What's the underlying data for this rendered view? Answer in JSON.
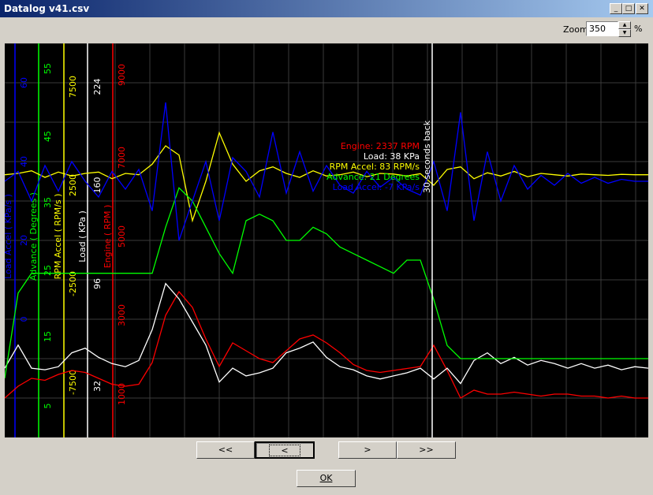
{
  "window": {
    "title": "Datalog v41.csv",
    "minimize": "_",
    "maximize": "□",
    "close": "✕"
  },
  "zoom": {
    "label": "Zoom",
    "value": "350",
    "unit": "%"
  },
  "buttons": {
    "first": "<<",
    "prev": "<",
    "next": ">",
    "last": ">>",
    "ok": "OK"
  },
  "colors": {
    "engine": "#ff0000",
    "load": "#ffffff",
    "rpm_accel": "#ffff00",
    "advance": "#00ff00",
    "load_accel": "#0000ff"
  },
  "axes": {
    "load_accel": {
      "label": "Load Accel ( KPa/s )"
    },
    "advance": {
      "label": "Advance ( Degrees )",
      "ticks": [
        "55",
        "45",
        "35",
        "25",
        "15",
        "5"
      ]
    },
    "rpm_accel": {
      "label": "RPM Accel ( RPM/s )",
      "ticks": [
        "7500",
        "2500",
        "-2500",
        "-7500"
      ]
    },
    "load": {
      "label": "Load ( KPa )",
      "ticks": [
        "224",
        "160",
        "96",
        "32"
      ]
    },
    "engine": {
      "label": "Engine ( RPM )",
      "ticks": [
        "9000",
        "7000",
        "5000",
        "3000",
        "1000"
      ]
    },
    "blue_ticks": [
      "60",
      "40",
      "20",
      "0"
    ]
  },
  "cursor": {
    "label": "30 seconds back"
  },
  "readout": {
    "engine": "Engine: 2337 RPM",
    "load": "Load: 38 KPa",
    "rpm_accel": "RPM Accel: 83 RPM/s",
    "advance": "Advance: 21 Degrees",
    "load_accel": "Load Accel: -7 KPa/s"
  },
  "chart_data": {
    "type": "line",
    "series": [
      {
        "name": "Engine",
        "values": [
          1000,
          1300,
          1500,
          1450,
          1600,
          1700,
          1650,
          1500,
          1350,
          1300,
          1350,
          1900,
          3100,
          3700,
          3300,
          2500,
          1800,
          2400,
          2200,
          2000,
          1900,
          2200,
          2500,
          2600,
          2400,
          2150,
          1850,
          1700,
          1650,
          1700,
          1750,
          1800,
          2337,
          1700,
          1000,
          1200,
          1100,
          1100,
          1150,
          1100,
          1050,
          1100,
          1100,
          1050,
          1050,
          1000,
          1050,
          1000,
          1000
        ]
      },
      {
        "name": "Load",
        "values": [
          45,
          60,
          45,
          44,
          46,
          55,
          58,
          52,
          48,
          46,
          50,
          70,
          100,
          90,
          75,
          60,
          36,
          45,
          40,
          42,
          45,
          55,
          58,
          62,
          52,
          46,
          44,
          40,
          38,
          40,
          42,
          45,
          38,
          45,
          35,
          50,
          55,
          48,
          52,
          47,
          50,
          48,
          45,
          48,
          45,
          47,
          44,
          46,
          45
        ]
      },
      {
        "name": "RPM Accel",
        "values": [
          0,
          100,
          300,
          -200,
          200,
          -100,
          100,
          200,
          -300,
          100,
          0,
          800,
          2200,
          1500,
          -3500,
          -500,
          3200,
          800,
          -500,
          300,
          600,
          100,
          -200,
          300,
          -100,
          0,
          200,
          -150,
          100,
          50,
          -100,
          83,
          -800,
          400,
          600,
          -300,
          150,
          -100,
          250,
          -150,
          100,
          0,
          -100,
          50,
          0,
          -50,
          30,
          0,
          0
        ]
      },
      {
        "name": "Advance",
        "values": [
          9,
          22,
          25,
          25,
          25,
          25,
          25,
          25,
          25,
          25,
          25,
          25,
          32,
          38,
          36,
          32,
          28,
          25,
          33,
          34,
          33,
          30,
          30,
          32,
          31,
          29,
          28,
          27,
          26,
          25,
          27,
          27,
          21,
          14,
          12,
          12,
          12,
          12,
          12,
          12,
          12,
          12,
          12,
          12,
          12,
          12,
          12,
          12,
          12
        ]
      },
      {
        "name": "Load Accel",
        "values": [
          0,
          5,
          -10,
          8,
          -5,
          10,
          0,
          -8,
          5,
          -4,
          6,
          -15,
          40,
          -30,
          -10,
          10,
          -20,
          12,
          5,
          -8,
          25,
          -6,
          15,
          -5,
          8,
          -2,
          -6,
          5,
          -3,
          2,
          -4,
          -7,
          10,
          -15,
          35,
          -20,
          15,
          -10,
          8,
          -4,
          3,
          -2,
          4,
          -1,
          2,
          -1,
          1,
          0,
          0
        ]
      }
    ]
  }
}
